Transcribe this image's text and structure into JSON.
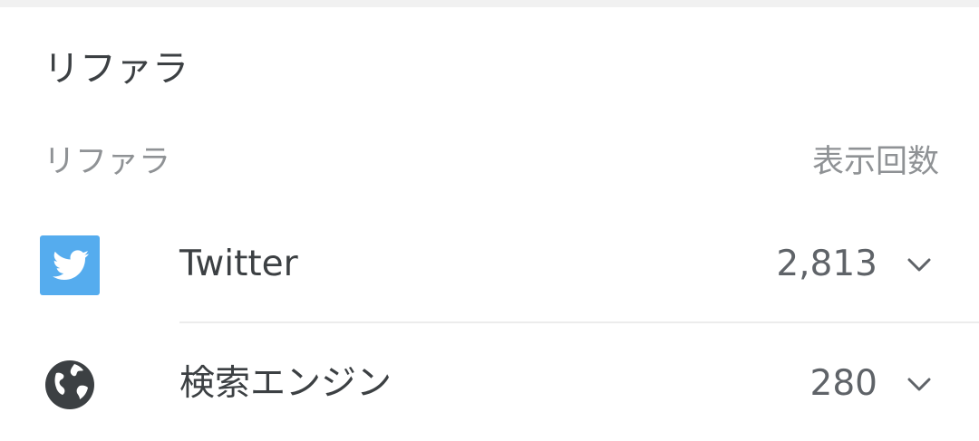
{
  "card": {
    "title": "リファラ"
  },
  "table": {
    "header_left": "リファラ",
    "header_right": "表示回数",
    "rows": [
      {
        "label": "Twitter",
        "value": "2,813",
        "icon": "twitter-icon",
        "icon_color": "#55acee"
      },
      {
        "label": "検索エンジン",
        "value": "280",
        "icon": "globe-icon",
        "icon_color": "#3c4043"
      }
    ]
  }
}
